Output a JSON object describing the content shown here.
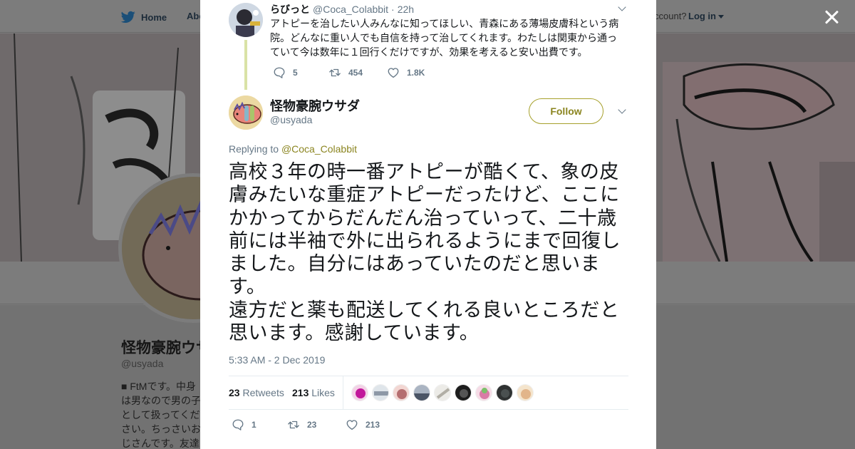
{
  "background": {
    "nav": {
      "home_label": "Home",
      "about_label": "Abo",
      "account_prompt": "ccount?",
      "login_label": "Log in"
    },
    "profile": {
      "name": "怪物豪腕ウサ",
      "handle": "@usyada",
      "bio": "■ FtMです。中身は男なので男の子として扱ってください。ちっさいおじさんです。友達にもLGBTQを知ってもらいたいですーとラフに生きたい。最近やっと広汎性発達…"
    },
    "close_icon": "close-icon"
  },
  "parent_tweet": {
    "name": "らびっと",
    "handle": "@Coca_Colabbit",
    "separator": "·",
    "time": "22h",
    "text": "アトピーを治したい人みんなに知ってほしい、青森にある薄場皮膚科という病院。どんなに重い人でも自信を持って治してくれます。わたしは関東から通っていて今は数年に１回行くだけですが、効果を考えると安い出費です。",
    "reply_count": "5",
    "retweet_count": "454",
    "like_count": "1.8K"
  },
  "main_tweet": {
    "name": "怪物豪腕ウサダ",
    "handle": "@usyada",
    "follow_label": "Follow",
    "replying_prefix": "Replying to",
    "replying_to": "@Coca_Colabbit",
    "text": "高校３年の時一番アトピーが酷くて、象の皮膚みたいな重症アトピーだったけど、ここにかかってからだんだん治っていって、二十歳前には半袖で外に出られるようにまで回復しました。自分にはあっていたのだと思います。\n遠方だと薬も配送してくれる良いところだと思います。感謝しています。",
    "timestamp": "5:33 AM - 2 Dec 2019",
    "retweets_count": "23",
    "retweets_label": "Retweets",
    "likes_count": "213",
    "likes_label": "Likes",
    "reply_count": "1",
    "retweet_count": "23",
    "like_count": "213"
  },
  "colors": {
    "accent": "#8b8520",
    "thread_line": "#d9e2a6",
    "text_primary": "#14171a",
    "text_secondary": "#657786"
  }
}
